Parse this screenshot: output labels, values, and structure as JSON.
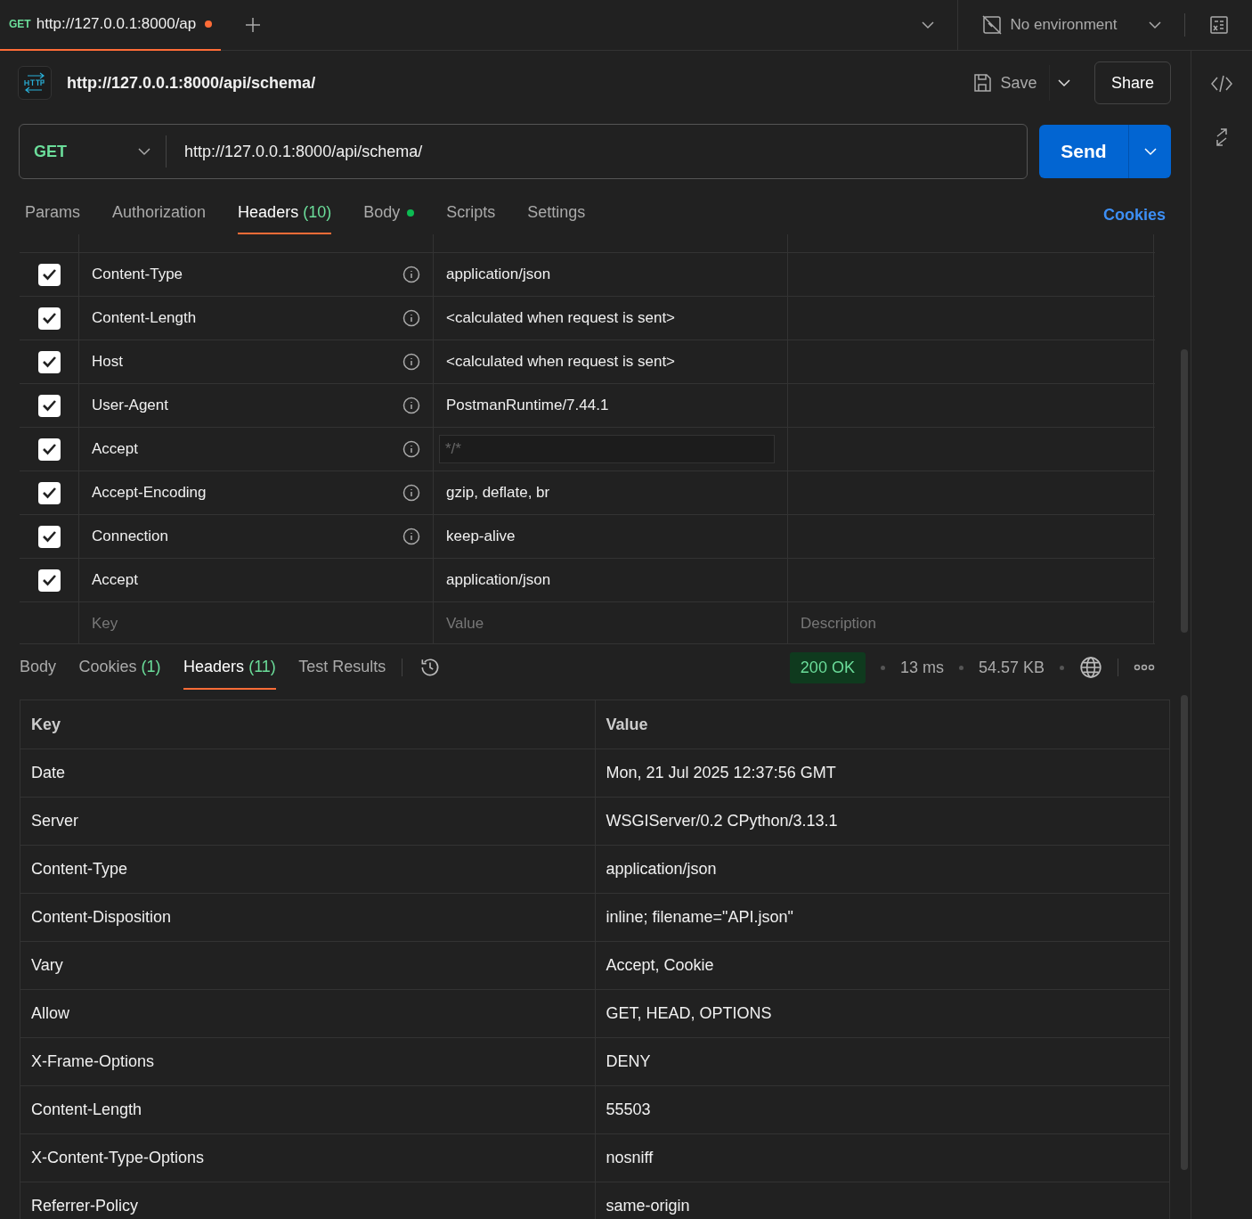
{
  "tab_bar": {
    "tab": {
      "method": "GET",
      "title": "http://127.0.0.1:8000/ap",
      "unsaved": true,
      "selected": true
    },
    "environment": "No environment"
  },
  "request": {
    "title": "http://127.0.0.1:8000/api/schema/",
    "save": "Save",
    "share": "Share",
    "method": "GET",
    "url": "http://127.0.0.1:8000/api/schema/",
    "send": "Send"
  },
  "request_tabs": [
    {
      "label": "Params",
      "selected": false,
      "dot": false
    },
    {
      "label": "Authorization",
      "selected": false,
      "dot": false
    },
    {
      "label": "Headers",
      "count": "(10)",
      "selected": true,
      "dot": false
    },
    {
      "label": "Body",
      "selected": false,
      "dot": true
    },
    {
      "label": "Scripts",
      "selected": false,
      "dot": false
    },
    {
      "label": "Settings",
      "selected": false,
      "dot": false
    }
  ],
  "cookies_link": "Cookies",
  "headers": [
    {
      "checked": true,
      "key": "Content-Type",
      "info": true,
      "value": "application/json"
    },
    {
      "checked": true,
      "key": "Content-Length",
      "info": true,
      "value": "<calculated when request is sent>"
    },
    {
      "checked": true,
      "key": "Host",
      "info": true,
      "value": "<calculated when request is sent>"
    },
    {
      "checked": true,
      "key": "User-Agent",
      "info": true,
      "value": "PostmanRuntime/7.44.1"
    },
    {
      "checked": true,
      "key": "Accept",
      "info": true,
      "placeholder": "*/*"
    },
    {
      "checked": true,
      "key": "Accept-Encoding",
      "info": true,
      "value": "gzip, deflate, br"
    },
    {
      "checked": true,
      "key": "Connection",
      "info": true,
      "value": "keep-alive"
    },
    {
      "checked": true,
      "key": "Accept",
      "info": false,
      "value": "application/json"
    }
  ],
  "new_header": {
    "key_placeholder": "Key",
    "value_placeholder": "Value",
    "description_placeholder": "Description"
  },
  "response_tabs": [
    {
      "label": "Body",
      "selected": false
    },
    {
      "label": "Cookies",
      "count": "(1)",
      "selected": false
    },
    {
      "label": "Headers",
      "count": "(11)",
      "selected": true
    },
    {
      "label": "Test Results",
      "selected": false
    }
  ],
  "response_status": {
    "status": "200 OK",
    "time": "13 ms",
    "size": "54.57 KB"
  },
  "response_headers": {
    "columns": [
      "Key",
      "Value"
    ],
    "rows": [
      [
        "Date",
        "Mon, 21 Jul 2025 12:37:56 GMT"
      ],
      [
        "Server",
        "WSGIServer/0.2 CPython/3.13.1"
      ],
      [
        "Content-Type",
        "application/json"
      ],
      [
        "Content-Disposition",
        "inline; filename=\"API.json\""
      ],
      [
        "Vary",
        "Accept, Cookie"
      ],
      [
        "Allow",
        "GET, HEAD, OPTIONS"
      ],
      [
        "X-Frame-Options",
        "DENY"
      ],
      [
        "Content-Length",
        "55503"
      ],
      [
        "X-Content-Type-Options",
        "nosniff"
      ],
      [
        "Referrer-Policy",
        "same-origin"
      ]
    ]
  }
}
